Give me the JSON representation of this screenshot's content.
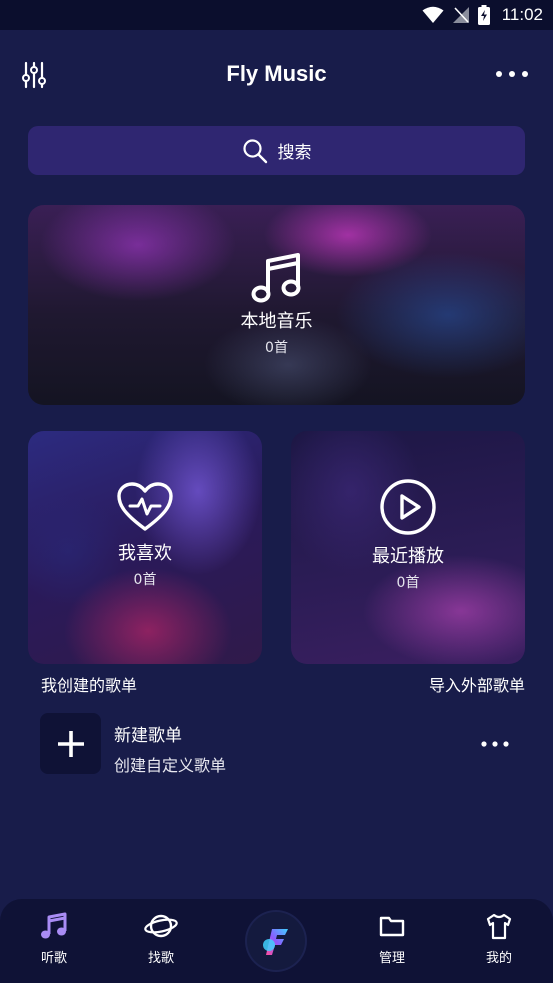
{
  "status_bar": {
    "time": "11:02"
  },
  "header": {
    "title": "Fly Music"
  },
  "search": {
    "placeholder": "搜索"
  },
  "cards": {
    "local": {
      "title": "本地音乐",
      "count": "0首"
    },
    "favorites": {
      "title": "我喜欢",
      "count": "0首"
    },
    "recent": {
      "title": "最近播放",
      "count": "0首"
    }
  },
  "playlists": {
    "created_label": "我创建的歌单",
    "import_label": "导入外部歌单",
    "new_item": {
      "title": "新建歌单",
      "subtitle": "创建自定义歌单"
    }
  },
  "bottom_nav": {
    "items": [
      {
        "label": "听歌",
        "icon": "music-note-icon"
      },
      {
        "label": "找歌",
        "icon": "planet-icon"
      },
      {
        "label": "",
        "icon": "fly-music-logo"
      },
      {
        "label": "管理",
        "icon": "folder-icon"
      },
      {
        "label": "我的",
        "icon": "tshirt-icon"
      }
    ]
  },
  "colors": {
    "background": "#181c4a",
    "search_bg": "#2f2671",
    "bottom_bar": "#0f1236",
    "accent_purple": "#a98cf5"
  }
}
